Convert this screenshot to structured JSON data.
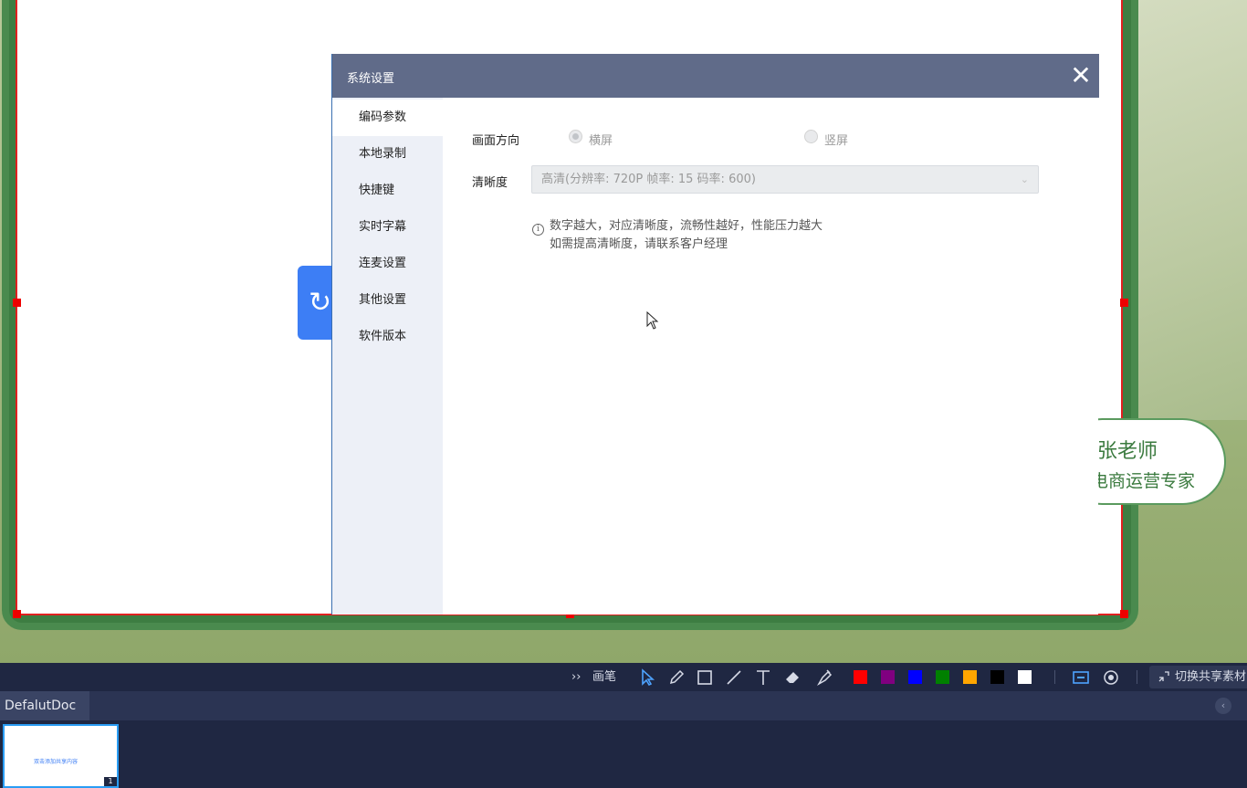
{
  "dialog": {
    "title": "系统设置",
    "close_glyph": "✕",
    "menu": [
      {
        "label": "编码参数",
        "active": true
      },
      {
        "label": "本地录制",
        "active": false
      },
      {
        "label": "快捷键",
        "active": false
      },
      {
        "label": "实时字幕",
        "active": false
      },
      {
        "label": "连麦设置",
        "active": false
      },
      {
        "label": "其他设置",
        "active": false
      },
      {
        "label": "软件版本",
        "active": false
      }
    ],
    "orientation": {
      "label": "画面方向",
      "options": [
        {
          "label": "横屏",
          "checked": true
        },
        {
          "label": "竖屏",
          "checked": false
        }
      ]
    },
    "quality": {
      "label": "清晰度",
      "value": "高清(分辨率: 720P  帧率: 15 码率: 600)",
      "chevron": "⌄"
    },
    "info": {
      "icon_glyph": "i",
      "line1": "数字越大，对应清晰度，流畅性越好，性能压力越大",
      "line2": "如需提高清晰度，请联系客户经理"
    }
  },
  "whiteboard": {
    "upload_glyph": "↻",
    "lecturer_name": "张老师",
    "lecturer_title": "电商运营专家"
  },
  "toolbar": {
    "expand_glyph": "››",
    "pen_label": "画笔",
    "tools": [
      "select-icon",
      "pencil-icon",
      "rectangle-icon",
      "line-icon",
      "text-icon",
      "eraser-icon",
      "clear-icon"
    ],
    "colors": [
      "#ff0000",
      "#800080",
      "#0000ff",
      "#008000",
      "#ffa500",
      "#000000",
      "#ffffff"
    ],
    "share_label": "切换共享素材"
  },
  "docbar": {
    "tab": "DefalutDoc",
    "collapse_glyph": "‹"
  },
  "thumbnail": {
    "caption": "双击添加共享内容",
    "page": "1"
  }
}
